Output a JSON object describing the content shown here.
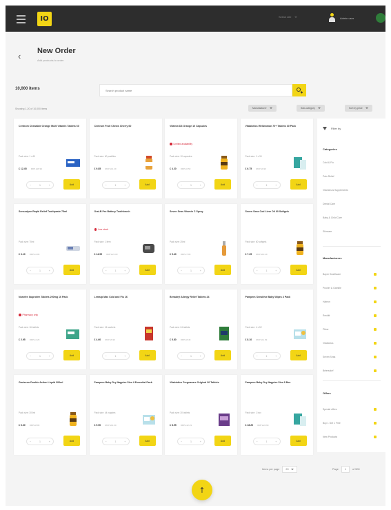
{
  "topbar": {
    "logo": "IO",
    "select_label": "Select site",
    "user_label": "Admin user"
  },
  "header": {
    "back": "‹",
    "title": "New Order",
    "subtitle": "Add products to order"
  },
  "toolbar": {
    "items_count": "10,000 items",
    "search_placeholder": "Search product name",
    "showing": "Showing 1-20 of 10,000 items",
    "filters": [
      "Manufacturer",
      "Sub-category",
      "Sort by price"
    ]
  },
  "colors": {
    "accent": "#f2d515",
    "topbar": "#2d2d2d",
    "rx": "#d6293a"
  },
  "products": [
    {
      "name": "Centrum Chewable Orange Multi Vitamin Tablets 60",
      "pack": "Pack size: 1 x 60",
      "price": "£ 12.45",
      "rrp": "RRP £18.99",
      "rx": "",
      "thumb": "box-blue"
    },
    {
      "name": "Centrum Fruit Chews Cherry 60",
      "pack": "Pack size: 60 pastilles",
      "price": "£ 9.85",
      "rrp": "RRP £14.49",
      "rx": "",
      "thumb": "bottle-orange"
    },
    {
      "name": "Vitamin D3 Orange 10 Capsules",
      "pack": "Pack size: 10 capsules",
      "price": "£ 4.20",
      "rrp": "RRP £6.50",
      "rx": "Limited availability",
      "thumb": "bottle-yellow"
    },
    {
      "name": "Vitabiotics Wellwoman 70+ Tablets 30 Pack",
      "pack": "Pack size: 1 x 30",
      "price": "£ 6.75",
      "rrp": "RRP £9.99",
      "rx": "",
      "thumb": "pack-teal"
    },
    {
      "name": "Sensodyne Rapid Relief Toothpaste 75ml",
      "pack": "Pack size: 75ml",
      "price": "£ 3.10",
      "rrp": "RRP £4.99",
      "rx": "",
      "thumb": "tube-grey"
    },
    {
      "name": "Oral-B Pro Battery Toothbrush",
      "pack": "Pack size: 1 item",
      "price": "£ 14.99",
      "rrp": "RRP £21.00",
      "rx": "Low stock",
      "thumb": "device-dark"
    },
    {
      "name": "Seven Seas Vitamin C Spray",
      "pack": "Pack size: 25ml",
      "price": "£ 5.40",
      "rrp": "RRP £7.99",
      "rx": "",
      "thumb": "spray-orange"
    },
    {
      "name": "Seven Seas Cod Liver Oil 60 Softgels",
      "pack": "Pack size: 60 softgels",
      "price": "£ 7.25",
      "rrp": "RRP £10.49",
      "rx": "",
      "thumb": "bottle-yellow"
    },
    {
      "name": "Nurofen Ibuprofen Tablets 200mg 16 Pack",
      "pack": "Pack size: 16 tablets",
      "price": "£ 2.95",
      "rrp": "RRP £4.29",
      "rx": "Pharmacy only",
      "thumb": "box-teal"
    },
    {
      "name": "Lemsip Max Cold and Flu 16",
      "pack": "Pack size: 16 sachets",
      "price": "£ 4.60",
      "rrp": "RRP £6.99",
      "rx": "",
      "thumb": "box-red"
    },
    {
      "name": "Benadryl Allergy Relief Tablets 24",
      "pack": "Pack size: 24 tablets",
      "price": "£ 5.80",
      "rrp": "RRP £8.49",
      "rx": "",
      "thumb": "box-green"
    },
    {
      "name": "Pampers Sensitive Baby Wipes 4 Pack",
      "pack": "Pack size: 4 x 52",
      "price": "£ 8.10",
      "rrp": "RRP £11.99",
      "rx": "",
      "thumb": "pack-light"
    },
    {
      "name": "Gaviscon Double Action Liquid 300ml",
      "pack": "Pack size: 300ml",
      "price": "£ 6.30",
      "rrp": "RRP £8.99",
      "rx": "",
      "thumb": "bottle-yellow"
    },
    {
      "name": "Pampers Baby Dry Nappies Size 4 Essential Pack",
      "pack": "Pack size: 44 nappies",
      "price": "£ 9.50",
      "rrp": "RRP £13.00",
      "rx": "",
      "thumb": "pack-light"
    },
    {
      "name": "Vitabiotics Pregnacare Original 30 Tablets",
      "pack": "Pack size: 30 tablets",
      "price": "£ 8.95",
      "rrp": "RRP £12.49",
      "rx": "",
      "thumb": "box-purple"
    },
    {
      "name": "Pampers Baby Dry Nappies Size 6 Box",
      "pack": "Pack size: 1 box",
      "price": "£ 18.20",
      "rrp": "RRP £24.99",
      "rx": "",
      "thumb": "pack-teal"
    }
  ],
  "card_labels": {
    "add": "Add",
    "qty": "1",
    "minus": "−",
    "plus": "+"
  },
  "sidebar": {
    "filter_label": "Filter by",
    "categories_title": "Categories",
    "categories": [
      "Cold & Flu",
      "Pain Relief",
      "Vitamins & Supplements",
      "Dental Care",
      "Baby & Child Care",
      "Skincare"
    ],
    "manufacturers_title": "Manufacturers",
    "manufacturers": [
      "Bayer Healthcare",
      "Procter & Gamble",
      "Haleon",
      "Reckitt",
      "Pfizer",
      "Vitabiotics",
      "Seven Seas",
      "Beiersdorf"
    ],
    "offers_title": "Offers",
    "offers": [
      "Special offers",
      "Buy 1 Get 1 Free",
      "New Products"
    ]
  },
  "pagination": {
    "per_page_label": "Items per page",
    "per_page": "20",
    "page_label": "Page",
    "page": "1",
    "of": "of 500"
  },
  "fab": {
    "label": "↑"
  }
}
